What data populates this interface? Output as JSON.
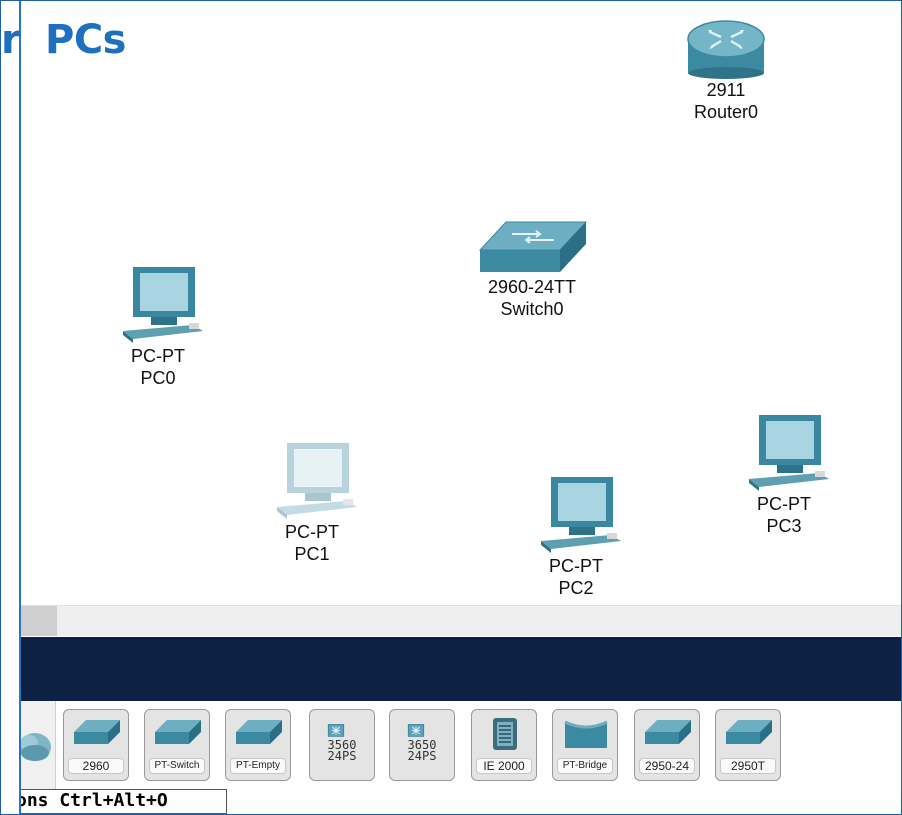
{
  "title": {
    "tail": "r",
    "main": "PCs"
  },
  "devices": {
    "router0": {
      "model": "2911",
      "name": "Router0",
      "icon": "router-icon"
    },
    "switch0": {
      "model": "2960-24TT",
      "name": "Switch0",
      "icon": "switch-icon"
    },
    "pc0": {
      "model": "PC-PT",
      "name": "PC0",
      "icon": "pc-icon"
    },
    "pc1": {
      "model": "PC-PT",
      "name": "PC1",
      "icon": "pc-icon"
    },
    "pc2": {
      "model": "PC-PT",
      "name": "PC2",
      "icon": "pc-icon"
    },
    "pc3": {
      "model": "PC-PT",
      "name": "PC3",
      "icon": "pc-icon"
    }
  },
  "palette": {
    "items": [
      {
        "label": "2960",
        "icon": "switch-icon"
      },
      {
        "label": "PT-Switch",
        "icon": "switch-icon"
      },
      {
        "label": "PT-Empty",
        "icon": "switch-icon"
      },
      {
        "label": "3560",
        "sub": "24PS",
        "icon": "multilayer-switch-icon"
      },
      {
        "label": "3650",
        "sub": "24PS",
        "icon": "multilayer-switch-icon"
      },
      {
        "label": "IE 2000",
        "icon": "industrial-switch-icon"
      },
      {
        "label": "PT-Bridge",
        "icon": "bridge-icon"
      },
      {
        "label": "2950-24",
        "icon": "switch-icon"
      },
      {
        "label": "2950T",
        "icon": "switch-icon"
      }
    ]
  },
  "tooltip": {
    "text": "ons Ctrl+Alt+O"
  },
  "colors": {
    "title": "#1f6fbf",
    "dark_bar": "#0d2144",
    "device_teal": "#3f8fa6",
    "frame_border": "#1f5fa8"
  }
}
